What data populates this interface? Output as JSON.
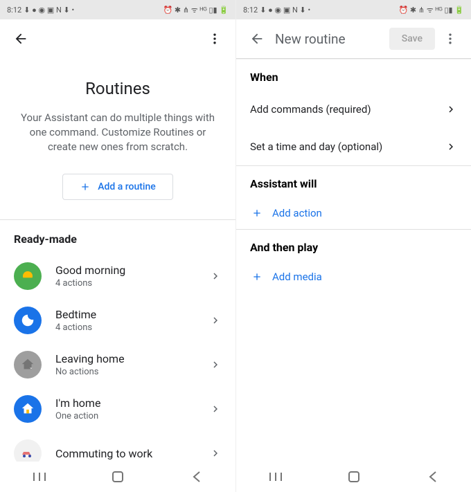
{
  "status": {
    "time": "8:12",
    "icons_left": "⬇ ● ◉ ▣ N ⬇ •",
    "icons_right": "⏰ ✱ ⋔ ᯤ ᴴᴳ ▯▮ 🔋"
  },
  "left": {
    "title": "Routines",
    "subtitle": "Your Assistant can do multiple things with one command. Customize Routines or create new ones from scratch.",
    "add_label": "Add a routine",
    "section": "Ready-made",
    "items": [
      {
        "name": "Good morning",
        "sub": "4 actions"
      },
      {
        "name": "Bedtime",
        "sub": "4 actions"
      },
      {
        "name": "Leaving home",
        "sub": "No actions"
      },
      {
        "name": "I'm home",
        "sub": "One action"
      },
      {
        "name": "Commuting to work",
        "sub": ""
      }
    ]
  },
  "right": {
    "title": "New routine",
    "save": "Save",
    "when": "When",
    "add_commands": "Add commands (required)",
    "set_time": "Set a time and day (optional)",
    "assistant_will": "Assistant will",
    "add_action": "Add action",
    "and_then_play": "And then play",
    "add_media": "Add media"
  }
}
